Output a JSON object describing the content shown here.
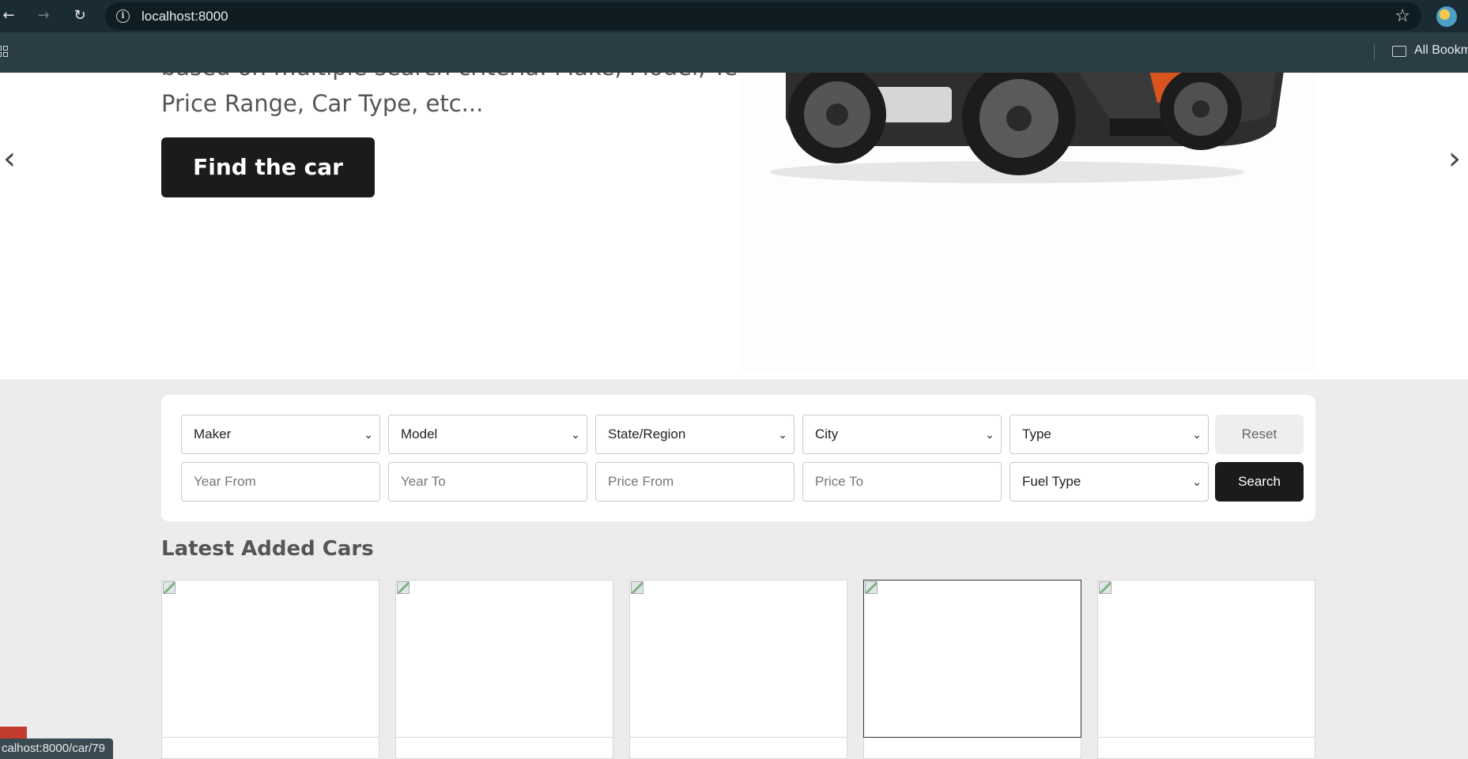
{
  "browser": {
    "url": "localhost:8000",
    "bookmarks_label": "All Bookm"
  },
  "hero": {
    "clipped_line": "based on multiple search criteria: Make, Model, Year,",
    "description": "Price Range, Car Type, etc...",
    "cta_label": "Find the car"
  },
  "search": {
    "maker": "Maker",
    "model": "Model",
    "state": "State/Region",
    "city": "City",
    "type": "Type",
    "reset_label": "Reset",
    "year_from_placeholder": "Year From",
    "year_to_placeholder": "Year To",
    "price_from_placeholder": "Price From",
    "price_to_placeholder": "Price To",
    "fuel_type": "Fuel Type",
    "search_label": "Search"
  },
  "latest": {
    "title": "Latest Added Cars"
  },
  "status": {
    "link": "calhost:8000/car/79"
  },
  "colors": {
    "dark_button": "#1b1b1b",
    "chrome_bg": "#1b2b33",
    "page_bg": "#ececec"
  }
}
